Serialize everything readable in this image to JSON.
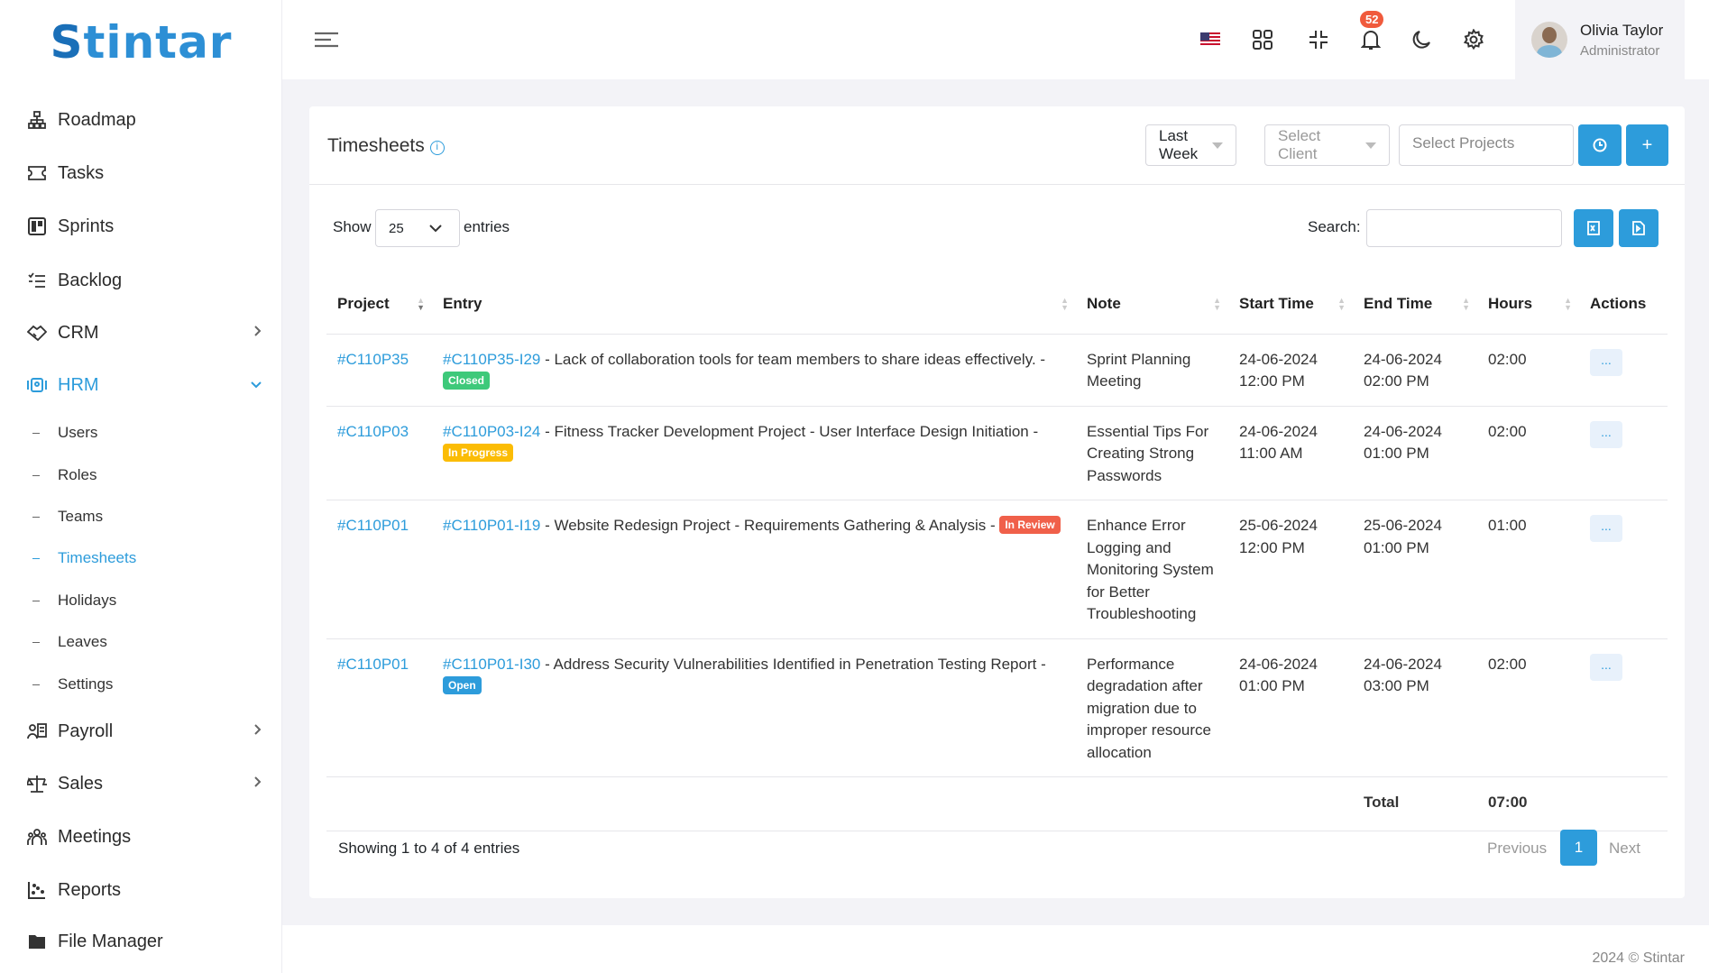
{
  "brand": {
    "logo": "Stintar",
    "accent": "#2d9cdb"
  },
  "sidebar": {
    "items": [
      {
        "label": "Roadmap",
        "icon": "sitemap-icon"
      },
      {
        "label": "Tasks",
        "icon": "ticket-icon"
      },
      {
        "label": "Sprints",
        "icon": "board-icon"
      },
      {
        "label": "Backlog",
        "icon": "list-check-icon"
      },
      {
        "label": "CRM",
        "icon": "handshake-icon",
        "chevron": "right"
      },
      {
        "label": "HRM",
        "icon": "id-card-icon",
        "chevron": "down",
        "active": true
      },
      {
        "label": "Payroll",
        "icon": "payroll-icon",
        "chevron": "right"
      },
      {
        "label": "Sales",
        "icon": "scale-icon",
        "chevron": "right"
      },
      {
        "label": "Meetings",
        "icon": "people-icon"
      },
      {
        "label": "Reports",
        "icon": "chart-icon"
      },
      {
        "label": "File Manager",
        "icon": "folder-icon"
      }
    ],
    "hrm_sub": [
      "Users",
      "Roles",
      "Teams",
      "Timesheets",
      "Holidays",
      "Leaves",
      "Settings"
    ],
    "active_sub": "Timesheets"
  },
  "header": {
    "notifications": "52",
    "user_name": "Olivia Taylor",
    "user_role": "Administrator"
  },
  "card": {
    "title": "Timesheets",
    "period": "Last Week",
    "client_placeholder": "Select Client",
    "projects_placeholder": "Select Projects"
  },
  "controls": {
    "show": "Show",
    "entries_value": "25",
    "entries": "entries",
    "search": "Search:"
  },
  "table": {
    "columns": [
      "Project",
      "Entry",
      "Note",
      "Start Time",
      "End Time",
      "Hours",
      "Actions"
    ],
    "rows": [
      {
        "project": "#C110P35",
        "entry_id": "#C110P35-I29",
        "entry_text": " - Lack of collaboration tools for team members to share ideas effectively. - ",
        "status": "Closed",
        "status_color": "#3ec97a",
        "note": "Sprint Planning Meeting",
        "start": "24-06-2024 12:00 PM",
        "end": "24-06-2024 02:00 PM",
        "hours": "02:00",
        "action": "..."
      },
      {
        "project": "#C110P03",
        "entry_id": "#C110P03-I24",
        "entry_text": " - Fitness Tracker Development Project - User Interface Design Initiation - ",
        "status": "In Progress",
        "status_color": "#fbbc05",
        "note": "Essential Tips For Creating Strong Passwords",
        "start": "24-06-2024 11:00 AM",
        "end": "24-06-2024 01:00 PM",
        "hours": "02:00",
        "action": "..."
      },
      {
        "project": "#C110P01",
        "entry_id": "#C110P01-I19",
        "entry_text": " - Website Redesign Project - Requirements Gathering & Analysis - ",
        "status": "In Review",
        "status_color": "#f0604a",
        "note": "Enhance Error Logging and Monitoring System for Better Troubleshooting",
        "start": "25-06-2024 12:00 PM",
        "end": "25-06-2024 01:00 PM",
        "hours": "01:00",
        "action": "..."
      },
      {
        "project": "#C110P01",
        "entry_id": "#C110P01-I30",
        "entry_text": " - Address Security Vulnerabilities Identified in Penetration Testing Report - ",
        "status": "Open",
        "status_color": "#2d9cdb",
        "note": "Performance degradation after migration due to improper resource allocation",
        "start": "24-06-2024 01:00 PM",
        "end": "24-06-2024 03:00 PM",
        "hours": "02:00",
        "action": "..."
      }
    ],
    "total_label": "Total",
    "total_hours": "07:00"
  },
  "pagination": {
    "info": "Showing 1 to 4 of 4 entries",
    "previous": "Previous",
    "page": "1",
    "next": "Next"
  },
  "footer": {
    "copyright": "2024 © Stintar"
  }
}
